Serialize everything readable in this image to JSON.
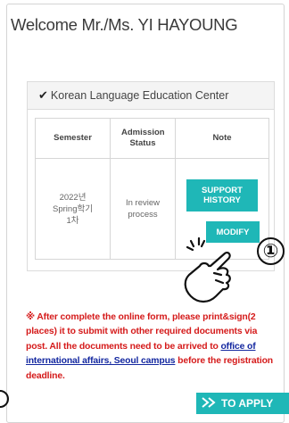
{
  "welcome": "Welcome Mr./Ms. YI HAYOUNG",
  "center": {
    "icon": "check-icon",
    "title": "Korean Language Education Center"
  },
  "table": {
    "headers": [
      "Semester",
      "Admission Status",
      "Note"
    ],
    "row": {
      "semester_line1": "2022년",
      "semester_line2": "Spring학기",
      "semester_line3": "1차",
      "status_line1": "In review",
      "status_line2": "process",
      "support_line1": "SUPPORT",
      "support_line2": "HISTORY",
      "modify": "MODIFY"
    }
  },
  "callout_number": "①",
  "notice": {
    "text1": "※ After complete the online form, please print&sign(2 places) it to submit with other required documents via post. All the documents need to be arrived to ",
    "link1": "office of international affairs, Seoul campus",
    "text2": " before the registration deadline."
  },
  "apply_button": "TO APPLY",
  "colors": {
    "teal": "#1fb7b7",
    "notice_red": "#d51b1b",
    "link_blue": "#1428a0"
  }
}
